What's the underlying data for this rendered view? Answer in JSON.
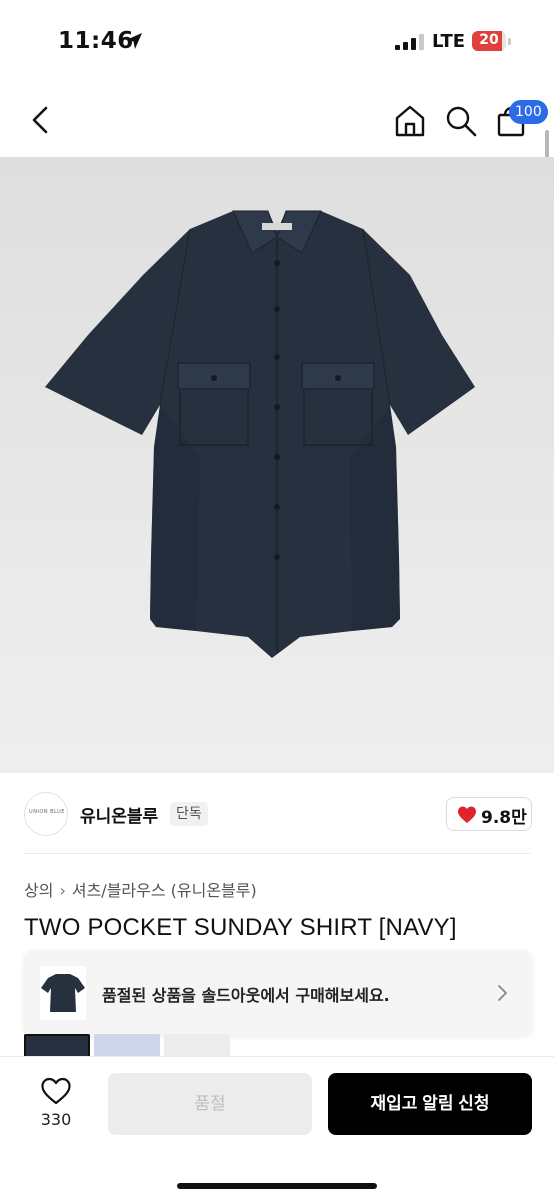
{
  "status_bar": {
    "time": "11:46",
    "network": "LTE",
    "battery": "20"
  },
  "nav": {
    "back_icon": "chevron-left-icon",
    "home_icon": "home-icon",
    "search_icon": "search-icon",
    "cart_icon": "shopping-bag-icon",
    "cart_badge": "100"
  },
  "product_image": {
    "alt": "TWO POCKET SUNDAY SHIRT [NAVY]"
  },
  "brand": {
    "logo_text": "UNION BLUE",
    "name": "유니온블루",
    "tag": "단독",
    "likes": "9.8만"
  },
  "breadcrumb": {
    "level1": "상의",
    "level2": "셔츠/블라우스 (유니온블루)"
  },
  "product": {
    "title": "TWO POCKET SUNDAY SHIRT [NAVY]"
  },
  "soldout_banner": {
    "text": "품절된 상품을 솔드아웃에서 구매해보세요."
  },
  "bottom_bar": {
    "wish_count": "330",
    "soldout_label": "품절",
    "restock_label": "재입고 알림 신청"
  },
  "colors": {
    "accent_badge": "#2b6be7",
    "like_heart": "#e0242b",
    "cta": "#000000",
    "shirt_navy": "#26303e"
  }
}
